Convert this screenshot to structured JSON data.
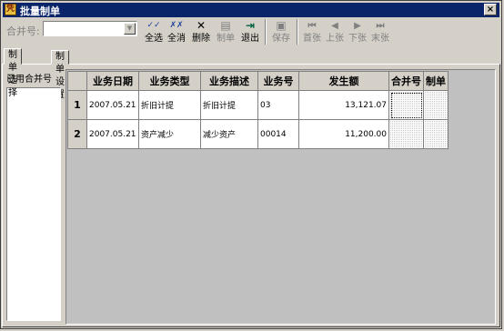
{
  "window": {
    "title": "批量制单",
    "close_glyph": "×",
    "icon_glyph": "凭"
  },
  "filter": {
    "label": "合并号:",
    "value": ""
  },
  "toolbar": [
    {
      "key": "select_all",
      "label": "全选",
      "icon": "check-all-icon",
      "glyph": "✓✓",
      "enabled": true
    },
    {
      "key": "deselect_all",
      "label": "全消",
      "icon": "uncheck-all-icon",
      "glyph": "✗✗",
      "enabled": true
    },
    {
      "key": "delete",
      "label": "删除",
      "icon": "delete-icon",
      "glyph": "✕",
      "enabled": true
    },
    {
      "key": "make_voucher",
      "label": "制单",
      "icon": "voucher-icon",
      "glyph": "▤",
      "enabled": false
    },
    {
      "key": "exit",
      "label": "退出",
      "icon": "exit-icon",
      "glyph": "⇥",
      "enabled": true
    },
    {
      "key": "save",
      "label": "保存",
      "icon": "save-icon",
      "glyph": "▣",
      "enabled": false
    },
    {
      "key": "first",
      "label": "首张",
      "icon": "first-icon",
      "glyph": "⏮",
      "enabled": false
    },
    {
      "key": "prev",
      "label": "上张",
      "icon": "prev-icon",
      "glyph": "◀",
      "enabled": false
    },
    {
      "key": "next",
      "label": "下张",
      "icon": "next-icon",
      "glyph": "▶",
      "enabled": false
    },
    {
      "key": "last",
      "label": "末张",
      "icon": "last-icon",
      "glyph": "⏭",
      "enabled": false
    }
  ],
  "tabs": [
    {
      "label": "制单选择",
      "active": true
    },
    {
      "label": "制单设置",
      "active": false
    }
  ],
  "used_merge": {
    "label": "已用合并号"
  },
  "grid": {
    "columns": [
      "业务日期",
      "业务类型",
      "业务描述",
      "业务号",
      "发生额",
      "合并号",
      "制单"
    ],
    "rows": [
      {
        "no": "1",
        "date": "2007.05.21",
        "type": "折旧计提",
        "desc": "折旧计提",
        "bizno": "03",
        "amount": "13,121.07",
        "merge": "",
        "make": ""
      },
      {
        "no": "2",
        "date": "2007.05.21",
        "type": "资产减少",
        "desc": "减少资产",
        "bizno": "00014",
        "amount": "11,200.00",
        "merge": "",
        "make": ""
      }
    ]
  }
}
